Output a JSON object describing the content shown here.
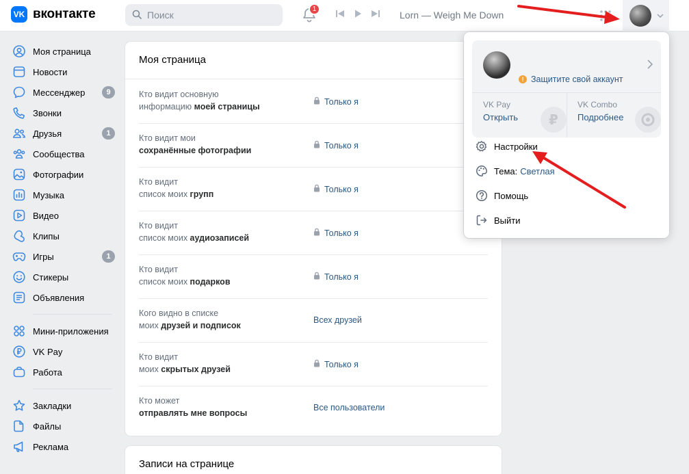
{
  "header": {
    "logo_letter": "VK",
    "logo_text": "вконтакте",
    "search_placeholder": "Поиск",
    "notifications_count": "1",
    "track": "Lorn — Weigh Me Down"
  },
  "sidebar": {
    "groups": [
      [
        {
          "label": "Моя страница",
          "icon": "user-circle-icon"
        },
        {
          "label": "Новости",
          "icon": "newspaper-icon"
        },
        {
          "label": "Мессенджер",
          "icon": "message-icon",
          "badge": "9"
        },
        {
          "label": "Звонки",
          "icon": "phone-icon"
        },
        {
          "label": "Друзья",
          "icon": "friends-icon",
          "badge": "1"
        },
        {
          "label": "Сообщества",
          "icon": "communities-icon"
        },
        {
          "label": "Фотографии",
          "icon": "photo-icon"
        },
        {
          "label": "Музыка",
          "icon": "music-icon"
        },
        {
          "label": "Видео",
          "icon": "video-icon"
        },
        {
          "label": "Клипы",
          "icon": "clips-icon"
        },
        {
          "label": "Игры",
          "icon": "gamepad-icon",
          "badge": "1"
        },
        {
          "label": "Стикеры",
          "icon": "smile-icon"
        },
        {
          "label": "Объявления",
          "icon": "ads-board-icon"
        }
      ],
      [
        {
          "label": "Мини-приложения",
          "icon": "mini-apps-icon"
        },
        {
          "label": "VK Pay",
          "icon": "ruble-icon"
        },
        {
          "label": "Работа",
          "icon": "briefcase-icon"
        }
      ],
      [
        {
          "label": "Закладки",
          "icon": "star-icon"
        },
        {
          "label": "Файлы",
          "icon": "file-icon"
        },
        {
          "label": "Реклама",
          "icon": "megaphone-icon"
        }
      ]
    ]
  },
  "main": {
    "title": "Моя страница",
    "rows": [
      {
        "line1": "Кто видит основную",
        "pre": "информацию ",
        "bold": "моей страницы",
        "value": "Только я",
        "locked": true
      },
      {
        "line1": "Кто видит мои",
        "pre": "",
        "bold": "сохранённые фотографии",
        "value": "Только я",
        "locked": true
      },
      {
        "line1": "Кто видит",
        "pre": "список моих ",
        "bold": "групп",
        "value": "Только я",
        "locked": true
      },
      {
        "line1": "Кто видит",
        "pre": "список моих ",
        "bold": "аудиозаписей",
        "value": "Только я",
        "locked": true
      },
      {
        "line1": "Кто видит",
        "pre": "список моих ",
        "bold": "подарков",
        "value": "Только я",
        "locked": true
      },
      {
        "line1": "Кого видно в списке",
        "pre": "моих ",
        "bold": "друзей и подписок",
        "value": "Всех друзей",
        "locked": false
      },
      {
        "line1": "Кто видит",
        "pre": "моих ",
        "bold": "скрытых друзей",
        "value": "Только я",
        "locked": true
      },
      {
        "line1": "Кто может",
        "pre": "",
        "bold": "отправлять мне вопросы",
        "value": "Все пользователи",
        "locked": false
      }
    ],
    "next_section_title": "Записи на странице"
  },
  "dropdown": {
    "protect_label": "Защитите свой аккаунт",
    "vkpay_name": "VK Pay",
    "vkpay_action": "Открыть",
    "vkcombo_name": "VK Combo",
    "vkcombo_action": "Подробнее",
    "settings_label": "Настройки",
    "theme_label": "Тема:",
    "theme_value": "Светлая",
    "help_label": "Помощь",
    "logout_label": "Выйти"
  },
  "colors": {
    "accent": "#0077ff",
    "link": "#2a5885",
    "annotation_arrow": "#e41e1e"
  }
}
